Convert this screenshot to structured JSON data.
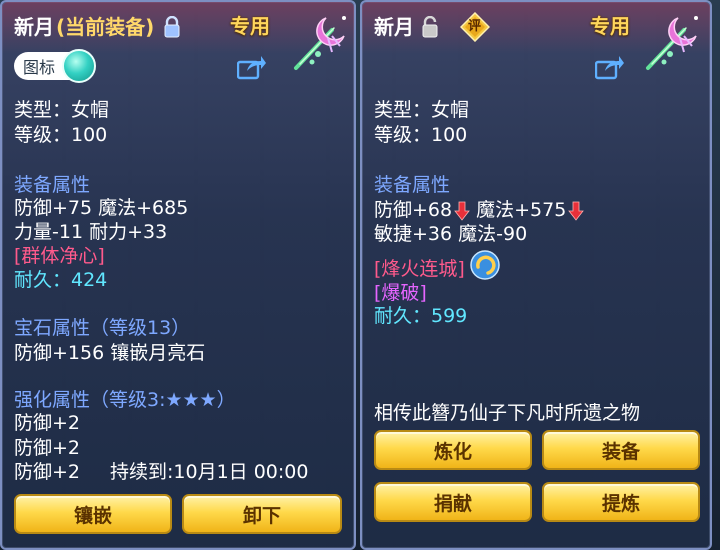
{
  "left_panel": {
    "item_name": "新月",
    "equipped_tag": "(当前装备)",
    "special_tag": "专用",
    "toggle_label": "图标",
    "type_line": "类型：女帽",
    "level_line": "等级：100",
    "attr_header": "装备属性",
    "attr_line1": "防御+75  魔法+685",
    "attr_line2": "力量-11  耐力+33",
    "skill": "[群体净心]",
    "durability": "耐久：424",
    "gem_header": "宝石属性（等级13）",
    "gem_line": "防御+156  镶嵌月亮石",
    "enhance_header": "强化属性（等级3:★★★）",
    "enhance_line1": "防御+2",
    "enhance_line2": "防御+2",
    "enhance_line3": "防御+2",
    "enhance_duration": "持续到:10月1日 00:00",
    "buttons": {
      "inlay": "镶嵌",
      "unequip": "卸下"
    }
  },
  "right_panel": {
    "item_name": "新月",
    "special_tag": "专用",
    "review_badge": "评",
    "type_line": "类型：女帽",
    "level_line": "等级：100",
    "attr_header": "装备属性",
    "attr_def": "防御+68",
    "attr_magic": "魔法+575",
    "attr_line2": "敏捷+36  魔法-90",
    "skill1": "[烽火连城]",
    "skill2": "[爆破]",
    "durability": "耐久：599",
    "description": "相传此簪乃仙子下凡时所遗之物",
    "buttons": {
      "refine": "炼化",
      "equip": "装备",
      "donate": "捐献",
      "extract": "提炼"
    }
  },
  "colors": {
    "white_text": "#ffffff",
    "header_blue": "#7ea8ff",
    "durability_cyan": "#61e7ff",
    "skill_red": "#ff5a8c",
    "skill_violet": "#e565ff",
    "button_gold": "#ffd94a",
    "down_arrow_red": "#e8303a"
  }
}
